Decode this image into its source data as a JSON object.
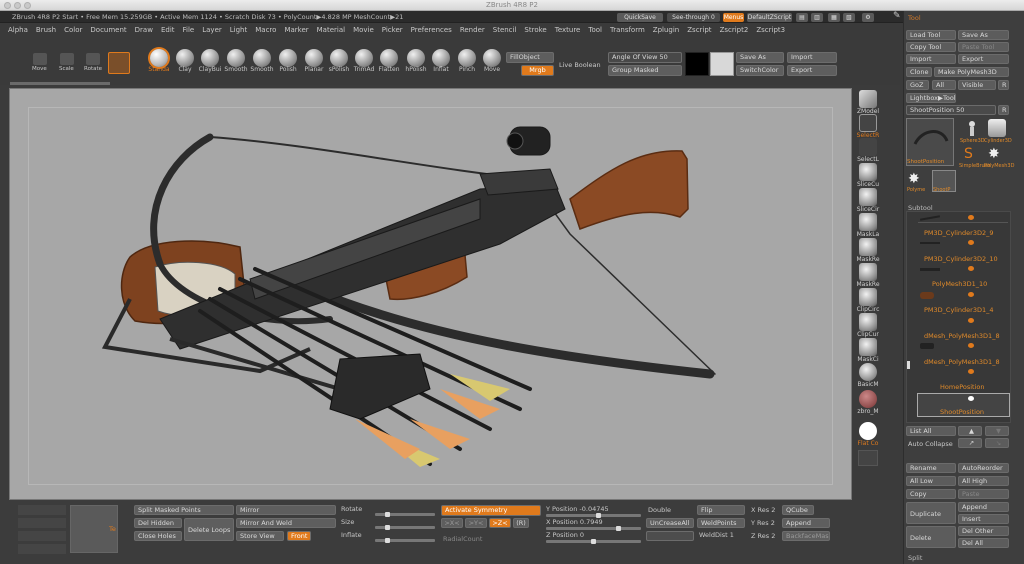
{
  "title": "ZBrush 4R8 P2",
  "infobar": "ZBrush 4R8 P2 Start   • Free Mem 15.259GB • Active Mem 1124 • Scratch Disk 73 • PolyCount▶4.828 MP   MeshCount▶21",
  "top_buttons": {
    "quicksave": "QuickSave",
    "seethrough": "See-through  0",
    "menus": "Menus",
    "default_zscript": "DefaultZScript"
  },
  "menu": [
    "Alpha",
    "Brush",
    "Color",
    "Document",
    "Draw",
    "Edit",
    "File",
    "Layer",
    "Light",
    "Macro",
    "Marker",
    "Material",
    "Movie",
    "Picker",
    "Preferences",
    "Render",
    "Stencil",
    "Stroke",
    "Texture",
    "Tool",
    "Transform",
    "Zplugin",
    "Zscript",
    "Zscript2",
    "Zscript3"
  ],
  "shelf_left": [
    "Move",
    "Scale",
    "Rotate"
  ],
  "brushes": [
    "Standa",
    "Clay",
    "ClayBui",
    "Smooth",
    "Smooth",
    "Polish",
    "Planar",
    "sPolish",
    "TrimAd",
    "Flatten",
    "hPolish",
    "Inflat",
    "Pinch",
    "Move"
  ],
  "toolbar": {
    "fill_object": "FillObject",
    "mrgb": "Mrgb",
    "live_boolean": "Live Boolean",
    "angle_of_view": "Angle Of View 50",
    "group_masked": "Group Masked",
    "save_as": "Save As",
    "switch_color": "SwitchColor",
    "import": "Import",
    "export": "Export"
  },
  "right_tools": [
    "ZModel",
    "SelectR",
    "SelectL",
    "SliceCu",
    "SliceCir",
    "MaskLa",
    "MaskRe",
    "MaskRe",
    "ClipCirc",
    "ClipCur",
    "MaskCi",
    "BasicM",
    "zbro_M",
    "Flat Co"
  ],
  "panel": {
    "header": "Tool",
    "load_tool": "Load Tool",
    "save_as": "Save As",
    "copy_tool": "Copy Tool",
    "paste_tool": "Paste Tool",
    "import": "Import",
    "export": "Export",
    "clone": "Clone",
    "make_polymesh": "Make PolyMesh3D",
    "goz": "GoZ",
    "all": "All",
    "visible": "Visible",
    "r": "R",
    "lightbox_tools": "Lightbox▶Tools",
    "shoot_position": "ShootPosition  50",
    "r2": "R",
    "thumbs": [
      "ShootPosition",
      "Sphere3D",
      "Cylinder3D",
      "SimpleBrush",
      "PolyMesh3D",
      "Polyme",
      "ShootP"
    ],
    "subtool_header": "Subtool",
    "subtools": [
      "PM3D_Cylinder3D2_9",
      "PM3D_Cylinder3D2_10",
      "PolyMesh3D1_10",
      "PM3D_Cylinder3D1_4",
      "dMesh_PolyMesh3D1_8",
      "dMesh_PolyMesh3D1_8",
      "HomePosition",
      "ShootPosition"
    ],
    "list_all": "List All",
    "auto_collapse": "Auto Collapse",
    "rename": "Rename",
    "auto_reorder": "AutoReorder",
    "all_low": "All Low",
    "all_high": "All High",
    "copy": "Copy",
    "paste": "Paste",
    "duplicate": "Duplicate",
    "append": "Append",
    "insert": "Insert",
    "delete": "Delete",
    "del_other": "Del Other",
    "del_all": "Del All",
    "split": "Split"
  },
  "bottom": {
    "split_masked": "Split Masked Points",
    "del_hidden": "Del Hidden",
    "close_holes": "Close Holes",
    "delete_loops": "Delete Loops",
    "mirror": "Mirror",
    "mirror_weld": "Mirror And Weld",
    "store_view": "Store View",
    "front": "Front",
    "rotate": "Rotate",
    "size": "Size",
    "inflate": "Inflate",
    "activate_symmetry": "Activate Symmetry",
    "x_sym": ">X<",
    "y_sym": ">Y<",
    "z_sym": ">Z<",
    "radial_count": "RadialCount",
    "y_position": "Y Position -0.04745",
    "x_position": "X Position 0.7949",
    "z_position": "Z Position 0",
    "double": "Double",
    "uncrease_all": "UnCreaseAll",
    "flip": "Flip",
    "weld_points": "WeldPoints",
    "weld_dist": "WeldDist 1",
    "x_res": "X Res 2",
    "y_res": "Y Res 2",
    "z_res": "Z Res 2",
    "qcube": "QCube",
    "append": "Append",
    "backface_mask": "BackfaceMask",
    "te": "Te"
  },
  "colors": {
    "accent": "#e07a1c",
    "canvas": "#a7a7a7",
    "wood": "#8b4a24",
    "metal": "#2c2c2c",
    "fletch_orange": "#e8a060",
    "fletch_yellow": "#d8c870"
  }
}
